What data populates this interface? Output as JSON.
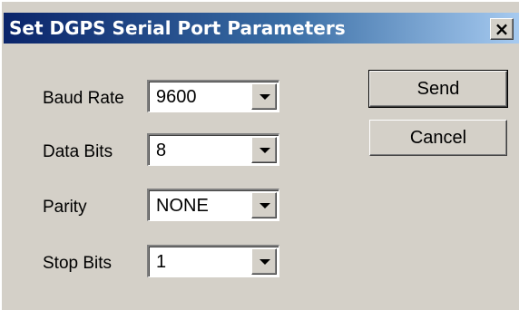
{
  "window": {
    "title": "Set DGPS Serial Port Parameters",
    "close_glyph": "✕"
  },
  "fields": [
    {
      "label": "Baud Rate",
      "value": "9600"
    },
    {
      "label": "Data Bits",
      "value": "8"
    },
    {
      "label": "Parity",
      "value": "NONE"
    },
    {
      "label": "Stop Bits",
      "value": "1"
    }
  ],
  "buttons": {
    "send": "Send",
    "cancel": "Cancel"
  },
  "colors": {
    "titlebar_start": "#0a246a",
    "titlebar_end": "#a6caf0",
    "face": "#d4d0c8"
  },
  "icons": {
    "close": "close-icon",
    "dropdown": "chevron-down-icon"
  }
}
